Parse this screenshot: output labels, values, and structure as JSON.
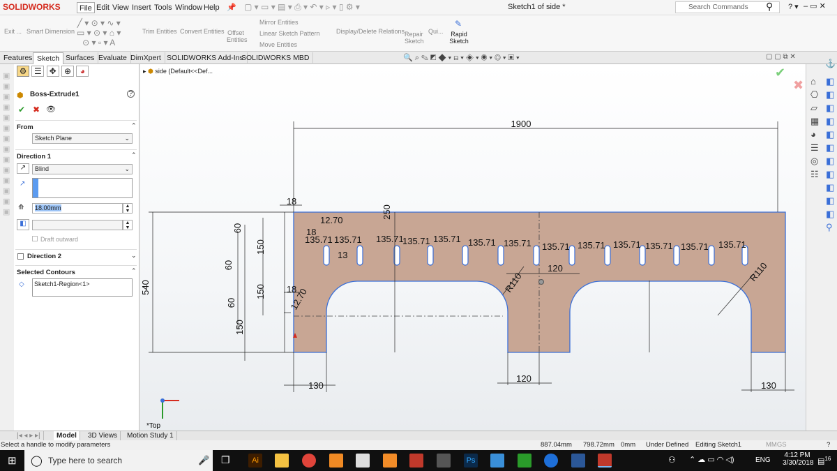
{
  "app": {
    "logo": "SOLIDWORKS",
    "title": "Sketch1 of side *"
  },
  "menu": [
    "File",
    "Edit",
    "View",
    "Insert",
    "Tools",
    "Window",
    "Help"
  ],
  "search": {
    "placeholder": "Search Commands"
  },
  "commands": {
    "exit": "Exit ...",
    "smart_dimension": "Smart Dimension",
    "trim": "Trim Entities",
    "convert": "Convert Entities",
    "offset": "Offset Entities",
    "mirror": "Mirror Entities",
    "linear_pattern": "Linear Sketch Pattern",
    "move": "Move Entities",
    "display_delete": "Display/Delete Relations",
    "repair": "Repair Sketch",
    "quick": "Qui...",
    "rapid": "Rapid Sketch"
  },
  "tabs": [
    "Features",
    "Sketch",
    "Surfaces",
    "Evaluate",
    "DimXpert",
    "SOLIDWORKS Add-Ins",
    "SOLIDWORKS MBD"
  ],
  "tree": {
    "node": "side  (Default<<Def..."
  },
  "panel": {
    "title": "Boss-Extrude1",
    "from_label": "From",
    "from_value": "Sketch Plane",
    "dir1_label": "Direction 1",
    "dir1_type": "Blind",
    "depth": "18.00mm",
    "draft": "Draft outward",
    "dir2_label": "Direction 2",
    "contours_label": "Selected Contours",
    "contour_item": "Sketch1-Region<1>"
  },
  "dims": {
    "total_width": "1900",
    "total_height": "540",
    "top_flange": "250",
    "d18a": "18",
    "d18b": "18",
    "d18c": "18",
    "d12_70a": "12.70",
    "d12_70b": "12.70",
    "d60a": "60",
    "d60b": "60",
    "d60c": "60",
    "d150a": "150",
    "d150b": "150",
    "d150c": "150",
    "r110a": "R110",
    "r110b": "R110",
    "gap": "120",
    "mid_leg": "120",
    "leg_left": "130",
    "leg_right": "130",
    "pitch": "135.71",
    "d13": "13"
  },
  "view": {
    "orientation": "*Top"
  },
  "bottom_tabs": [
    "Model",
    "3D Views",
    "Motion Study 1"
  ],
  "status": {
    "message": "Select a handle to modify parameters",
    "x": "887.04mm",
    "y": "798.72mm",
    "z": "0mm",
    "state": "Under Defined",
    "editing": "Editing Sketch1",
    "units": "MMGS"
  },
  "taskbar": {
    "search": "Type here to search",
    "lang": "ENG",
    "time": "4:12 PM",
    "date": "3/30/2018",
    "badge": "16"
  },
  "colors": {
    "part": "#c8a694",
    "edge": "#3a6fd8",
    "dim": "#111111",
    "accent": "#d52b1e"
  }
}
